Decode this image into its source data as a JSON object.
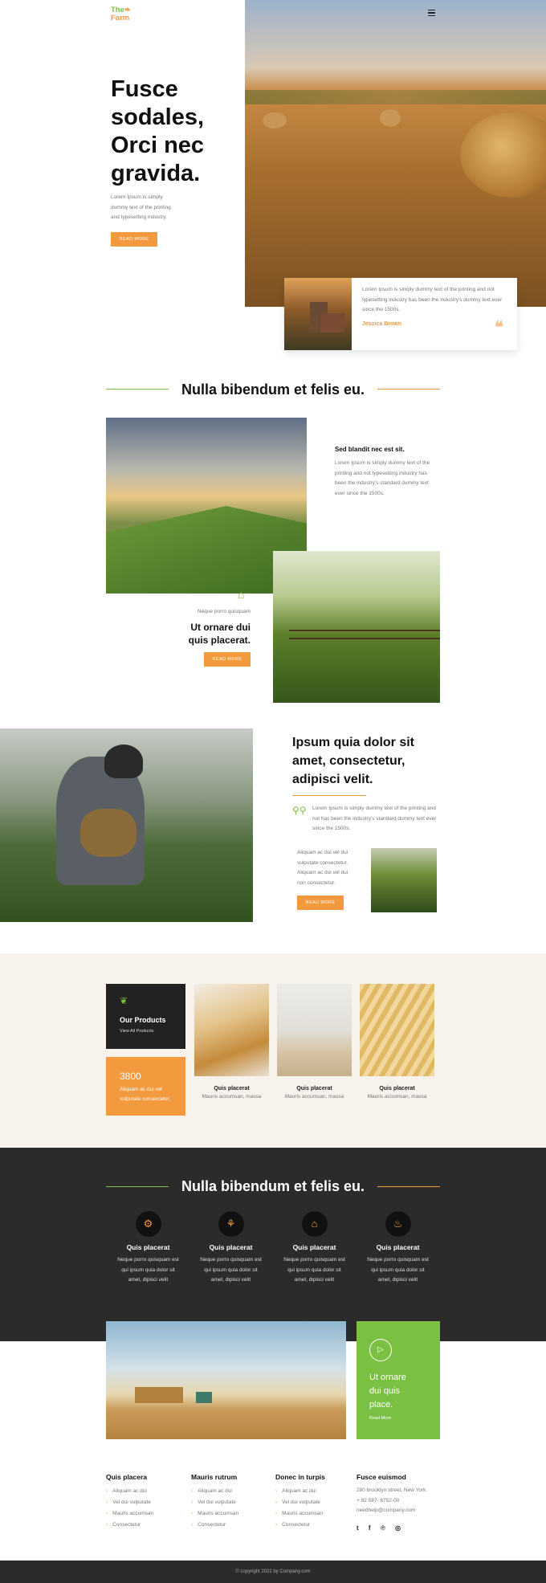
{
  "header": {
    "logo_line1": "The",
    "logo_line2": "Farm"
  },
  "hero": {
    "title_lines": [
      "Fusce",
      "sodales,",
      "Orci nec",
      "gravida."
    ],
    "text_lines": [
      "Lorem Ipsum is simply",
      "dummy text of the printing",
      "and typesetting industry."
    ],
    "button": "READ MORE",
    "quote": {
      "text_lines": [
        "Lorem Ipsum is simply dummy text of the printing and not",
        "typesetting industry has been the industry's dummy text ever",
        "since the 1500s."
      ],
      "author": "Jessica Brown"
    }
  },
  "section1": {
    "title": "Nulla bibendum et felis eu.",
    "card1": {
      "heading": "Sed blandit nec est sit.",
      "text_lines": [
        "Lorem Ipsum is simply dummy text of the",
        "printing and not typesetting industry has",
        "been the industry's standard dummy text",
        "ever since the 1500s."
      ]
    },
    "card2": {
      "small": "Neque porro quisquam",
      "title_lines": [
        "Ut ornare dui",
        "quis placerat."
      ],
      "button": "READ MORE"
    }
  },
  "section2": {
    "title_lines": [
      "Ipsum quia dolor sit",
      "amet, consectetur,",
      "adipisci velit."
    ],
    "text_lines": [
      "Lorem Ipsum is simply dummy text of the printing and",
      "not has been the industry's standard dummy text ever",
      "since the 1500s."
    ],
    "sub_lines": [
      "Aliquam ac dui vel dui",
      "vulputate consectetur.",
      "Aliquam ac dui vel dui",
      "non consectetur."
    ],
    "button": "READ MORE"
  },
  "products": {
    "dark_card": {
      "title": "Our Products",
      "link": "View All Products"
    },
    "orange_card": {
      "number": "3800",
      "text_lines": [
        "Aliquam ac dui vel",
        "vulputate consectetur."
      ]
    },
    "items": [
      {
        "title": "Quis placerat",
        "sub": "Mauris accumsan, massa"
      },
      {
        "title": "Quis placerat",
        "sub": "Mauris accumsan, massa"
      },
      {
        "title": "Quis placerat",
        "sub": "Mauris accumsan, massa"
      }
    ]
  },
  "services": {
    "title": "Nulla bibendum et felis eu.",
    "items": [
      {
        "icon": "tractor-icon",
        "title": "Quis placerat",
        "text_lines": [
          "Neque porro quisquam est",
          "qui ipsum quia dolor sit",
          "amet, dipisci velit"
        ]
      },
      {
        "icon": "sprout-icon",
        "title": "Quis placerat",
        "text_lines": [
          "Neque porro quisquam est",
          "qui ipsum quia dolor sit",
          "amet, dipisci velit"
        ]
      },
      {
        "icon": "barn-icon",
        "title": "Quis placerat",
        "text_lines": [
          "Neque porro quisquam est",
          "qui ipsum quia dolor sit",
          "amet, dipisci velit"
        ]
      },
      {
        "icon": "bowl-icon",
        "title": "Quis placerat",
        "text_lines": [
          "Neque porro quisquam est",
          "qui ipsum quia dolor sit",
          "amet, dipisci velit"
        ]
      }
    ]
  },
  "video": {
    "title_lines": [
      "Ut ornare",
      "dui quis",
      "place."
    ],
    "link": "Read More"
  },
  "footer": {
    "cols": [
      {
        "title": "Quis placera",
        "items": [
          "Aliquam ac dui",
          "Vel dui vulputate",
          "Mauris accumsan",
          "Consectetur"
        ]
      },
      {
        "title": "Mauris rutrum",
        "items": [
          "Aliquam ac dui",
          "Vel dui vulputate",
          "Mauris accumsan",
          "Consectetur"
        ]
      },
      {
        "title": "Donec in turpis",
        "items": [
          "Aliquam ac dui",
          "Vel dui vulputate",
          "Mauris accumsan",
          "Consectetur"
        ]
      }
    ],
    "contact": {
      "title": "Fusce euismod",
      "lines": [
        "280 brooklyn street, New York",
        "+ 92 587- 6752-00",
        "needhelp@company.com"
      ]
    },
    "copyright": "© copyright 2021 by Company.com"
  },
  "colors": {
    "orange": "#f39a3e",
    "green": "#7ac143",
    "dark": "#2b2b2b",
    "cream": "#f7f2ec"
  }
}
